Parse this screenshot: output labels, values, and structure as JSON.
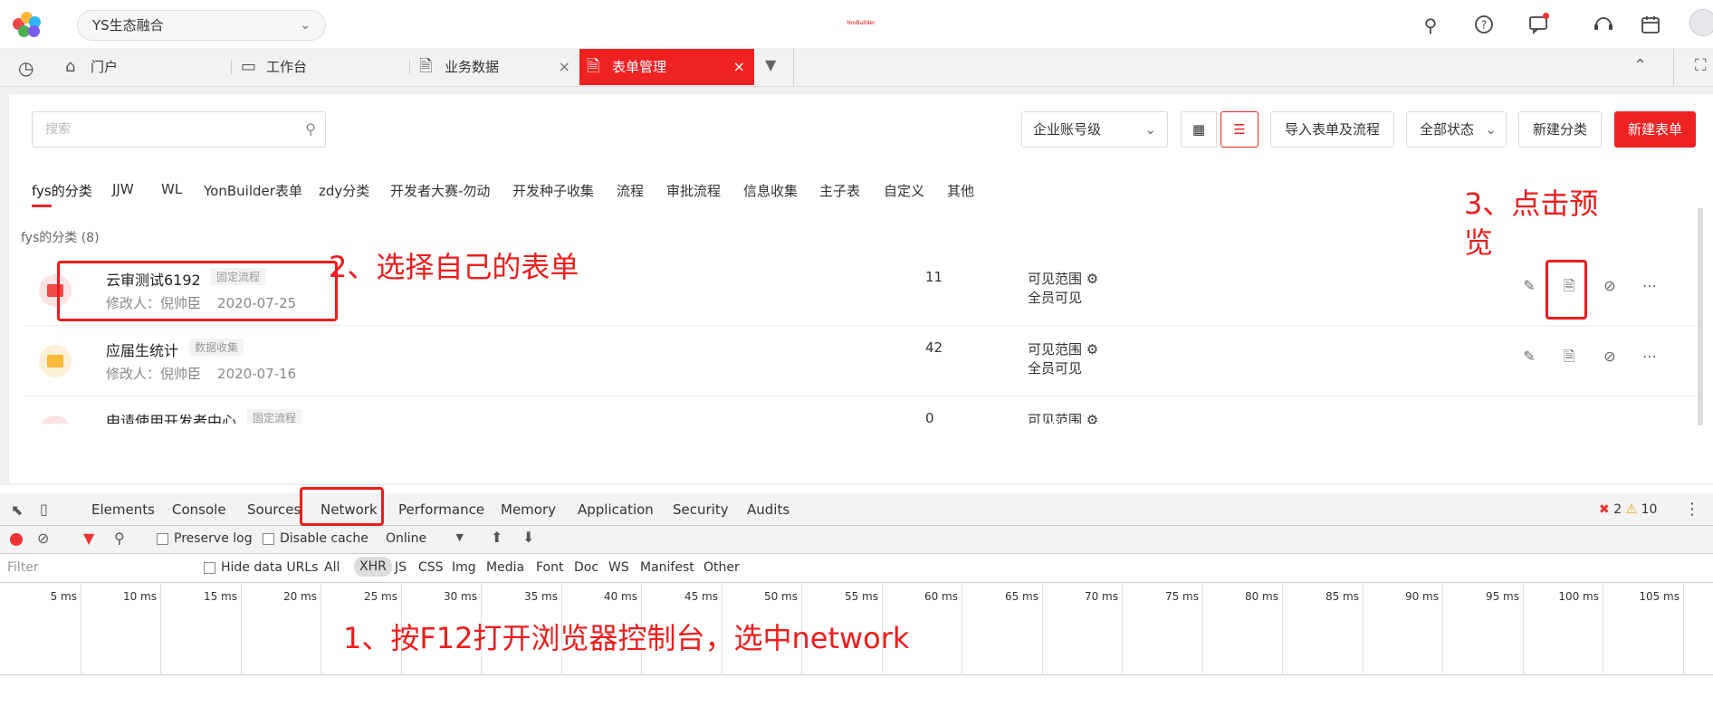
{
  "org_selector": {
    "value": "YS生态融合"
  },
  "brand": "YonBuilder",
  "top_icons": [
    "search-icon",
    "help-icon",
    "message-icon",
    "support-icon",
    "calendar-icon"
  ],
  "tabs": [
    {
      "label": "门户",
      "icon": "home-icon"
    },
    {
      "label": "工作台",
      "icon": "monitor-icon"
    },
    {
      "label": "业务数据",
      "icon": "document-icon"
    },
    {
      "label": "表单管理",
      "icon": "document-icon",
      "active": true
    }
  ],
  "toolbar": {
    "search_placeholder": "搜索",
    "level_select": "企业账号级",
    "import_label": "导入表单及流程",
    "status_select": "全部状态",
    "new_category": "新建分类",
    "new_form": "新建表单"
  },
  "categories": [
    "fys的分类",
    "JJW",
    "WL",
    "YonBuilder表单",
    "zdy分类",
    "开发者大赛-勿动",
    "开发种子收集",
    "流程",
    "审批流程",
    "信息收集",
    "主子表",
    "自定义",
    "其他"
  ],
  "group_label": "fys的分类 (8)",
  "forms": [
    {
      "title": "云审测试6192",
      "tag": "固定流程",
      "modifier_label": "修改人：",
      "modifier": "倪帅臣",
      "date": "2020-07-25",
      "count": "11",
      "visibility_label": "可见范围",
      "visibility": "全员可见",
      "icon_color": "#f04848",
      "icon_bg": "#fde3e3"
    },
    {
      "title": "应届生统计",
      "tag": "数据收集",
      "modifier_label": "修改人：",
      "modifier": "倪帅臣",
      "date": "2020-07-16",
      "count": "42",
      "visibility_label": "可见范围",
      "visibility": "全员可见",
      "icon_color": "#f7b93a",
      "icon_bg": "#fdf0d6"
    },
    {
      "title": "申请使用开发者中心",
      "tag": "固定流程",
      "modifier_label": "",
      "modifier": "",
      "date": "",
      "count": "0",
      "visibility_label": "可见范围",
      "visibility": "",
      "icon_color": "#f04848",
      "icon_bg": "#fde3e3"
    }
  ],
  "devtools": {
    "tabs": [
      "Elements",
      "Console",
      "Sources",
      "Network",
      "Performance",
      "Memory",
      "Application",
      "Security",
      "Audits"
    ],
    "errors": "2",
    "warnings": "10",
    "preserve_log": "Preserve log",
    "disable_cache": "Disable cache",
    "throttle": "Online",
    "filter_placeholder": "Filter",
    "hide_data_urls": "Hide data URLs",
    "filter_types": [
      "All",
      "XHR",
      "JS",
      "CSS",
      "Img",
      "Media",
      "Font",
      "Doc",
      "WS",
      "Manifest",
      "Other"
    ],
    "timeline_ticks": [
      "5 ms",
      "10 ms",
      "15 ms",
      "20 ms",
      "25 ms",
      "30 ms",
      "35 ms",
      "40 ms",
      "45 ms",
      "50 ms",
      "55 ms",
      "60 ms",
      "65 ms",
      "70 ms",
      "75 ms",
      "80 ms",
      "85 ms",
      "90 ms",
      "95 ms",
      "100 ms",
      "105 ms"
    ]
  },
  "annotations": {
    "step1": "1、按F12打开浏览器控制台，选中network",
    "step2": "2、选择自己的表单",
    "step3_line1": "3、点击预",
    "step3_line2": "览"
  }
}
